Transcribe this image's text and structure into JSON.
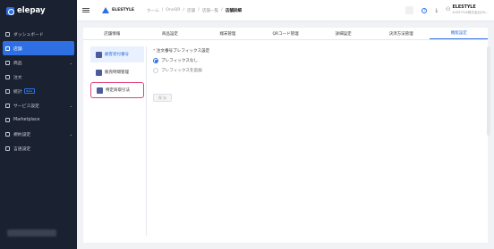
{
  "app": {
    "logo_text": "elepay"
  },
  "sidebar": {
    "items": [
      {
        "label": "ダッシュボード",
        "icon": "dashboard-icon",
        "chevron": ""
      },
      {
        "label": "店舗",
        "icon": "store-icon",
        "chevron": "",
        "active": true
      },
      {
        "label": "商品",
        "icon": "product-icon",
        "chevron": "⌄"
      },
      {
        "label": "注文",
        "icon": "order-icon",
        "chevron": ""
      },
      {
        "label": "統計",
        "icon": "stats-icon",
        "chevron": "",
        "badge": "Beta"
      },
      {
        "label": "サービス設定",
        "icon": "service-settings-icon",
        "chevron": "⌄"
      },
      {
        "label": "Marketplace",
        "icon": "marketplace-icon",
        "chevron": ""
      },
      {
        "label": "規約設定",
        "icon": "terms-icon",
        "chevron": "⌄"
      },
      {
        "label": "言語設定",
        "icon": "language-icon",
        "chevron": ""
      }
    ]
  },
  "header": {
    "brand": "ELESTYLE",
    "breadcrumb": [
      "ホーム",
      "/",
      "OneQR",
      "/",
      "店舗",
      "/",
      "店舗一覧",
      "/"
    ],
    "breadcrumb_current": "店舗詳細",
    "help_glyph": "?",
    "download_glyph": "⤓",
    "account_name": "ELESTYLE",
    "account_sub": "ELESTYLE株式会社(Te...",
    "person_glyph": "⚇"
  },
  "tabs": [
    "店舗情報",
    "商品設定",
    "端末管理",
    "QRコード管理",
    "詳細設定",
    "決済方法管理",
    "機能設定"
  ],
  "active_tab_index": 6,
  "left_menu": [
    {
      "label": "顧客受付番号",
      "active": true,
      "highlighted": false
    },
    {
      "label": "販売時間管理",
      "active": false,
      "highlighted": false
    },
    {
      "label": "特定商取引法",
      "active": false,
      "highlighted": true
    }
  ],
  "form": {
    "required_mark": "*",
    "title": "注文番号プレフィックス設定",
    "options": [
      {
        "label": "プレフィックスなし",
        "selected": true
      },
      {
        "label": "プレフィックスを追加",
        "selected": false
      }
    ],
    "save_label": "保 存"
  },
  "colors": {
    "accent": "#2f6fe4",
    "sidebar_bg": "#1a2130",
    "highlight": "#e0447a"
  }
}
